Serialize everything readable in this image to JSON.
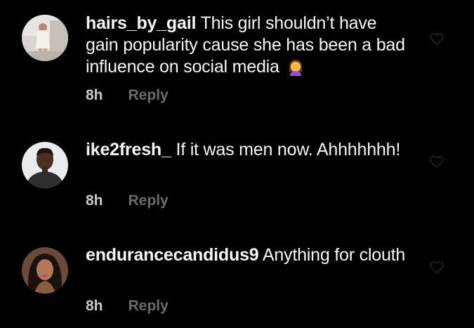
{
  "comments": [
    {
      "username": "hairs_by_gail",
      "text": "This girl shouldn’t have gain popularity cause she has been a bad influence on social media",
      "emoji": "woman-facepalming-emoji",
      "time": "8h",
      "reply_label": "Reply",
      "avatar": "avatar-photo-woman-white-outfit"
    },
    {
      "username": "ike2fresh_",
      "text": "If it was men now. Ahhhhhhh!",
      "time": "8h",
      "reply_label": "Reply",
      "avatar": "avatar-photo-man-dark-shirt"
    },
    {
      "username": "endurancecandidus9",
      "text": "Anything for clouth",
      "time": "8h",
      "reply_label": "Reply",
      "avatar": "avatar-photo-woman-long-hair"
    }
  ],
  "icons": {
    "like": "heart-outline-icon"
  },
  "colors": {
    "background": "#000000",
    "text": "#f5f5f5",
    "time": "#c9c9c9",
    "reply": "#6b6b6b"
  }
}
